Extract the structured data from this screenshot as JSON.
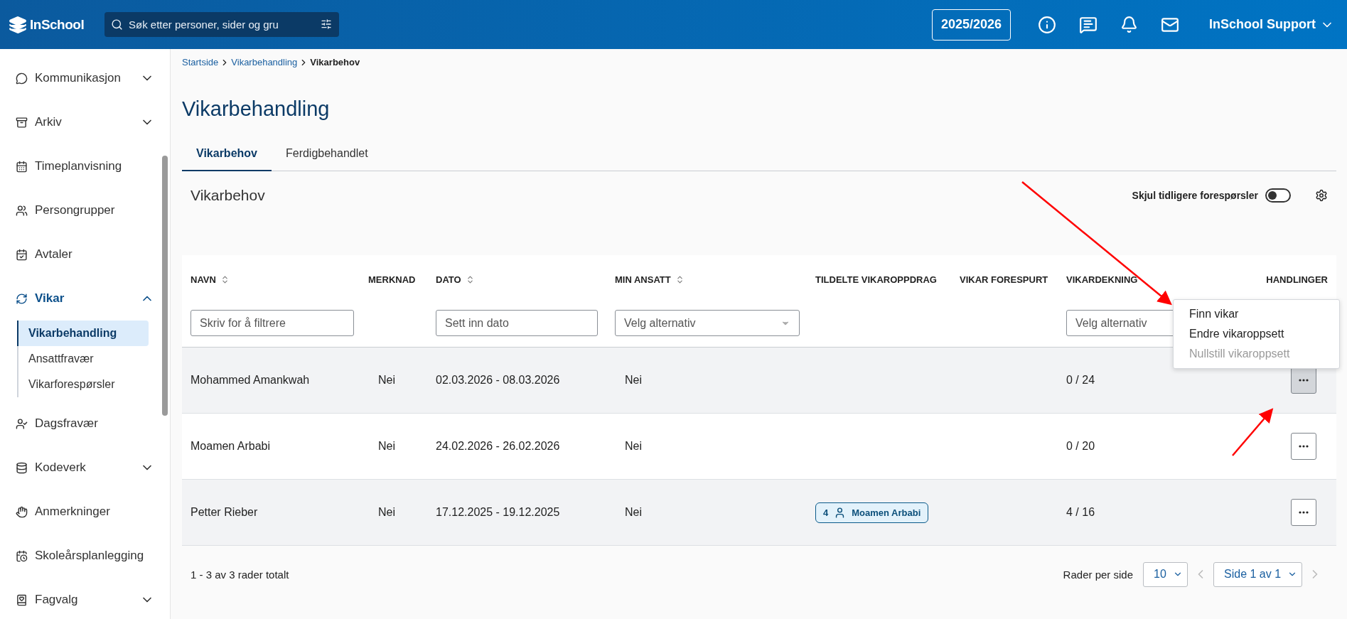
{
  "topbar": {
    "logo": "InSchool",
    "search": {
      "placeholder": "Søk etter personer, sider og gru"
    },
    "school_year": "2025/2026",
    "user": "InSchool Support"
  },
  "sidebar": {
    "items": [
      {
        "label": "Kommunikasjon",
        "kind": "group",
        "expanded": false,
        "selected": false
      },
      {
        "label": "Arkiv",
        "kind": "group",
        "expanded": false,
        "selected": false
      },
      {
        "label": "Timeplanvisning",
        "kind": "link",
        "selected": false
      },
      {
        "label": "Persongrupper",
        "kind": "link",
        "selected": false
      },
      {
        "label": "Avtaler",
        "kind": "link",
        "selected": false
      },
      {
        "label": "Vikar",
        "kind": "group",
        "expanded": true,
        "selected": true,
        "children": [
          {
            "label": "Vikarbehandling",
            "selected": true
          },
          {
            "label": "Ansattfravær",
            "selected": false
          },
          {
            "label": "Vikarforespørsler",
            "selected": false
          }
        ]
      },
      {
        "label": "Dagsfravær",
        "kind": "link",
        "selected": false
      },
      {
        "label": "Kodeverk",
        "kind": "group",
        "expanded": false,
        "selected": false
      },
      {
        "label": "Anmerkninger",
        "kind": "link",
        "selected": false
      },
      {
        "label": "Skoleårsplanlegging",
        "kind": "link",
        "selected": false
      },
      {
        "label": "Fagvalg",
        "kind": "group",
        "expanded": false,
        "selected": false
      }
    ]
  },
  "breadcrumb": [
    {
      "label": "Startside",
      "current": false
    },
    {
      "label": "Vikarbehandling",
      "current": false
    },
    {
      "label": "Vikarbehov",
      "current": true
    }
  ],
  "title": "Vikarbehandling",
  "tabs": [
    {
      "label": "Vikarbehov",
      "selected": true
    },
    {
      "label": "Ferdigbehandlet",
      "selected": false
    }
  ],
  "card": {
    "title": "Vikarbehov",
    "toggle": {
      "label": "Skjul tidligere forespørsler",
      "on": false
    }
  },
  "table": {
    "columns": [
      {
        "label": "NAVN",
        "sortable": true,
        "filter": {
          "kind": "text",
          "placeholder": "Skriv for å filtrere"
        }
      },
      {
        "label": "MERKNAD",
        "sortable": false
      },
      {
        "label": "DATO",
        "sortable": true,
        "filter": {
          "kind": "text",
          "placeholder": "Sett inn dato"
        }
      },
      {
        "label": "MIN ANSATT",
        "sortable": true,
        "filter": {
          "kind": "select",
          "placeholder": "Velg alternativ"
        }
      },
      {
        "label": "TILDELTE VIKAROPPDRAG",
        "sortable": false
      },
      {
        "label": "VIKAR FORESPURT",
        "sortable": false
      },
      {
        "label": "VIKARDEKNING",
        "sortable": false,
        "filter": {
          "kind": "select",
          "placeholder": "Velg alternativ",
          "caret_hidden": true
        }
      },
      {
        "label": "HANDLINGER",
        "sortable": false
      }
    ],
    "rows": [
      {
        "navn": "Mohammed Amankwah",
        "merknad": "Nei",
        "dato": "02.03.2026 - 08.03.2026",
        "min_ansatt": "Nei",
        "dekning": "0 / 24",
        "menu_open": true
      },
      {
        "navn": "Moamen Arbabi",
        "merknad": "Nei",
        "dato": "24.02.2026 - 26.02.2026",
        "min_ansatt": "Nei",
        "dekning": "0 / 20",
        "menu_open": false
      },
      {
        "navn": "Petter Rieber",
        "merknad": "Nei",
        "dato": "17.12.2025 - 19.12.2025",
        "min_ansatt": "Nei",
        "tildelt": {
          "count": "4",
          "name": "Moamen Arbabi"
        },
        "dekning": "4 / 16",
        "menu_open": false
      }
    ],
    "action_menu": [
      {
        "label": "Finn vikar",
        "disabled": false
      },
      {
        "label": "Endre vikaroppsett",
        "disabled": false
      },
      {
        "label": "Nullstill vikaroppsett",
        "disabled": true
      }
    ]
  },
  "footer": {
    "summary": "1 - 3 av 3 rader totalt",
    "rows_per_page_label": "Rader per side",
    "rows_per_page": "10",
    "page": "Side 1 av 1",
    "prev_disabled": true,
    "next_disabled": true
  }
}
